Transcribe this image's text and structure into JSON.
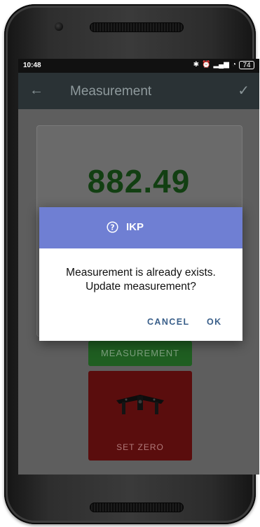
{
  "status_bar": {
    "time": "10:48",
    "icons": [
      "bluetooth-icon",
      "alarm-icon",
      "signal-icon",
      "wifi-icon"
    ],
    "battery": "74"
  },
  "app_bar": {
    "back_icon": "arrow-left-icon",
    "title": "Measurement",
    "confirm_icon": "check-icon"
  },
  "main": {
    "value": "882.49",
    "measurement_button": "MEASUREMENT",
    "set_zero_button": "SET ZERO",
    "colors": {
      "value_green": "#123f12",
      "button_green": "#1f5e21",
      "button_red": "#5a0d0d"
    }
  },
  "dialog": {
    "title": "IKP",
    "icon": "help-circle-icon",
    "message_line1": "Measurement is already exists.",
    "message_line2": "Update measurement?",
    "cancel_label": "CANCEL",
    "ok_label": "OK",
    "header_color": "#6f7fd3"
  }
}
